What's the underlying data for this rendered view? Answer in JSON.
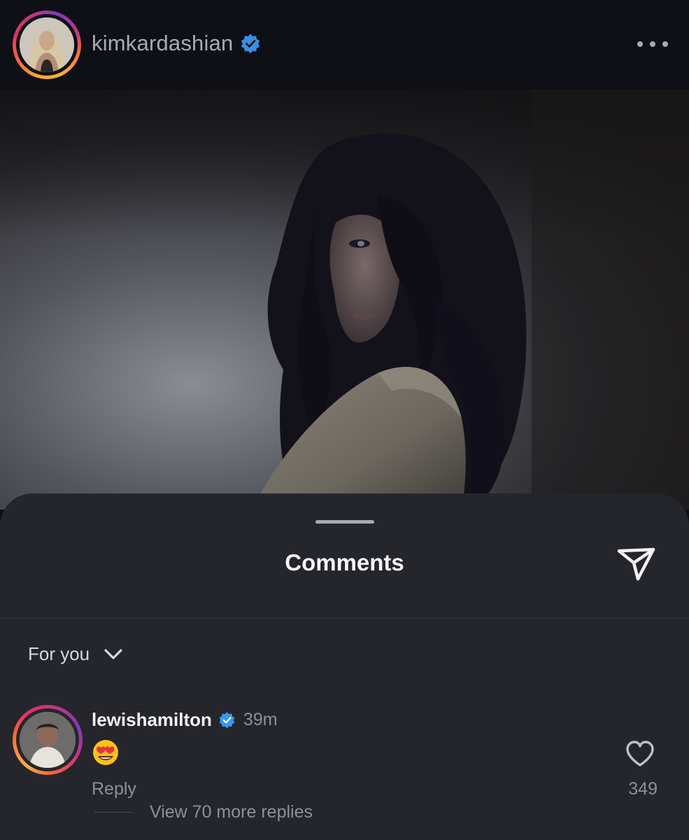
{
  "post": {
    "username": "kimkardashian",
    "verified_icon": "verified-badge-icon",
    "more_icon": "more-horizontal-icon"
  },
  "comments_sheet": {
    "title": "Comments",
    "share_icon": "paper-plane-icon",
    "sort_label": "For you",
    "sort_icon": "chevron-down-icon"
  },
  "comments": [
    {
      "username": "lewishamilton",
      "verified": true,
      "time": "39m",
      "emoji_icon": "heart-eyes-emoji",
      "reply_label": "Reply",
      "likes": "349",
      "like_icon": "heart-outline-icon",
      "view_replies_label": "View 70 more replies"
    }
  ],
  "colors": {
    "background": "#0d0f14",
    "sheet": "#25262c",
    "verified_blue": "#3897f0",
    "secondary_text": "#8e9097"
  }
}
